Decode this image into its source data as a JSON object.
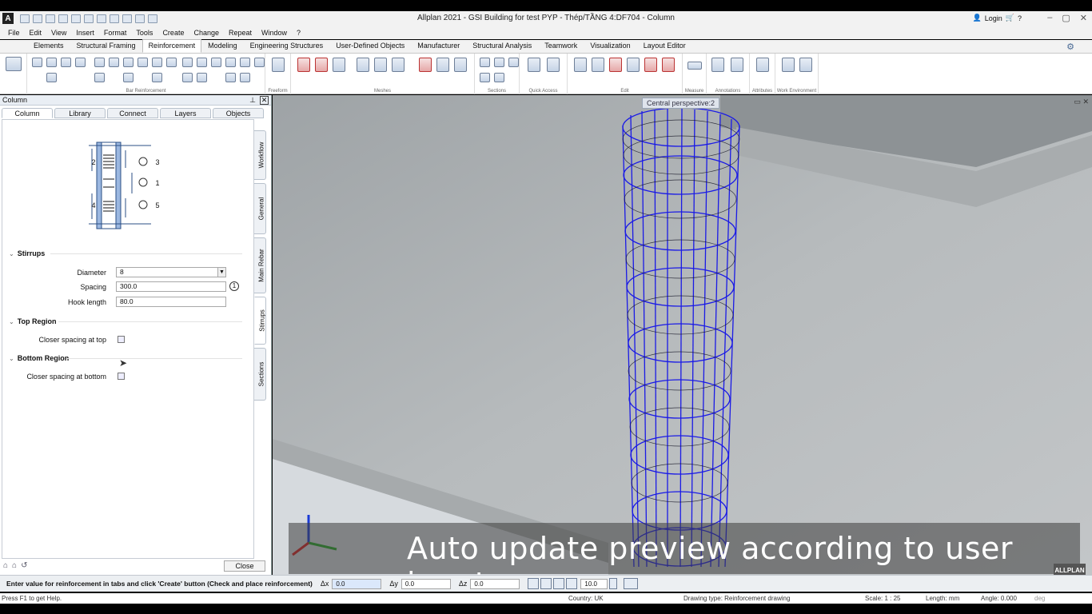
{
  "window": {
    "title": "Allplan 2021 - GSI Building for test PYP - Thép/TẦNG 4:DF704 - Column",
    "login": "Login",
    "app_letter": "A"
  },
  "menu": [
    "File",
    "Edit",
    "View",
    "Insert",
    "Format",
    "Tools",
    "Create",
    "Change",
    "Repeat",
    "Window",
    "?"
  ],
  "ribbon_tabs": [
    "Elements",
    "Structural Framing",
    "Reinforcement",
    "Modeling",
    "Engineering Structures",
    "User-Defined Objects",
    "Manufacturer",
    "Structural Analysis",
    "Teamwork",
    "Visualization",
    "Layout Editor"
  ],
  "active_ribbon_tab": "Reinforcement",
  "ribbon_groups": [
    "Bar Reinforcement",
    "Freeform",
    "Meshes",
    "Sections",
    "Quick Access",
    "Edit",
    "Measure",
    "Annotations",
    "Attributes",
    "Work Environment"
  ],
  "panel": {
    "title": "Column",
    "tabs": [
      "Column",
      "Library",
      "Connect",
      "Layers",
      "Objects"
    ],
    "side_tabs": [
      "Workflow",
      "General",
      "Main Rebar",
      "Stirrups",
      "Sections"
    ],
    "diagram_callouts": [
      "2",
      "3",
      "1",
      "4",
      "5"
    ],
    "stirrups": {
      "heading": "Stirrups",
      "diameter_label": "Diameter",
      "diameter": "8",
      "spacing_label": "Spacing",
      "spacing": "300.0",
      "hook_label": "Hook length",
      "hook": "80.0",
      "info": "1"
    },
    "top": {
      "heading": "Top Region",
      "label": "Closer spacing at top"
    },
    "bottom": {
      "heading": "Bottom Region",
      "label": "Closer spacing at bottom"
    },
    "close": "Close"
  },
  "viewport": {
    "label": "Central perspective:2",
    "banner": "Auto update preview according to user input",
    "brand": "ALLPLAN"
  },
  "cmd": {
    "prompt": "Enter value for reinforcement in tabs and click 'Create' button (Check and place reinforcement)",
    "dx_label": "Δx",
    "dx": "0.0",
    "dy_label": "Δy",
    "dy": "0.0",
    "dz_label": "Δz",
    "dz": "0.0",
    "step": "10.0"
  },
  "status": {
    "help": "Press F1 to get Help.",
    "country": "Country: UK",
    "drawing_type": "Drawing type:   Reinforcement drawing",
    "scale": "Scale:   1 : 25",
    "length": "Length:   mm",
    "angle": "Angle:  0.000",
    "deg": "deg"
  },
  "colors": {
    "rebar": "#1a1ae6",
    "accent": "#3a6fb0"
  }
}
